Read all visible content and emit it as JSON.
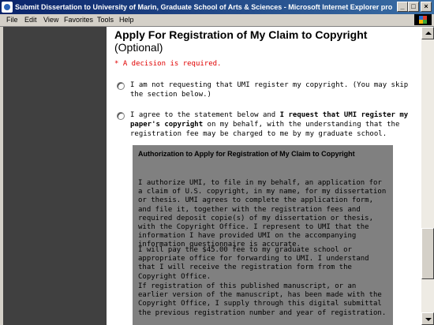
{
  "window": {
    "title": "Submit Dissertation to University of Marin, Graduate School of Arts & Sciences - Microsoft Internet Explorer provided by ProQ...",
    "min_label": "_",
    "max_label": "□",
    "close_label": "×"
  },
  "menu": {
    "items": [
      "File",
      "Edit",
      "View",
      "Favorites",
      "Tools",
      "Help"
    ]
  },
  "content": {
    "heading": "Apply For Registration of My Claim to Copyright",
    "subheading": "(Optional)",
    "required": "* A decision is required.",
    "option1": "I am not requesting that UMI register my copyright. (You may skip the section below.)",
    "option2_pre": "I agree to the statement below and ",
    "option2_bold": "I request that UMI register my paper's copyright",
    "option2_post": " on my behalf, with the understanding that the registration fee may be charged to me by my graduate school.",
    "auth_title": "Authorization to Apply for Registration of My Claim to Copyright",
    "auth_p1": "I authorize UMI, to file in my behalf, an application for a claim of U.S. copyright, in my name, for my dissertation or thesis. UMI agrees to complete the application form, and file it, together with the registration fees and required deposit copie(s) of my dissertation or thesis, with the Copyright Office. I represent to UMI that the information I have provided UMI on the accompanying information questionnaire is accurate.",
    "auth_p2": "I will pay the $45.00 fee to my graduate school or appropriate office for forwarding to UMI. I understand that I will receive the registration form from the Copyright Office.",
    "auth_p3": "If registration of this published manuscript, or an earlier version of the manuscript, has been made with the Copyright Office, I supply through this digital submittal the previous registration number and year of registration."
  }
}
